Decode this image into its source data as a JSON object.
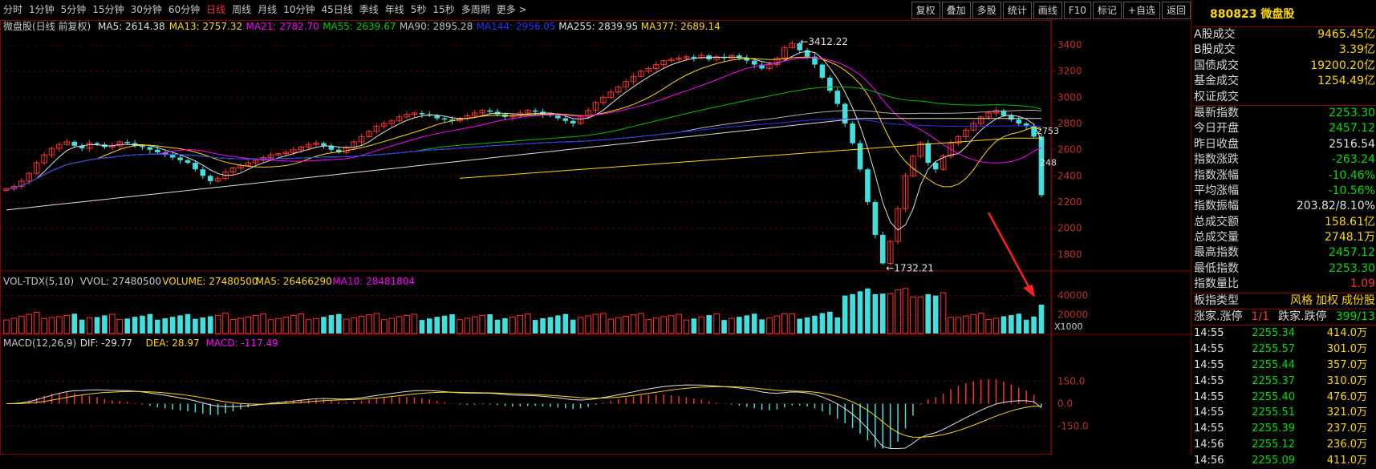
{
  "toolbar": {
    "tabs": [
      "分时",
      "1分钟",
      "5分钟",
      "15分钟",
      "30分钟",
      "60分钟",
      "日线",
      "周线",
      "月线",
      "10分钟",
      "45日线",
      "季线",
      "年线",
      "5秒",
      "15秒",
      "多周期",
      "更多 >"
    ],
    "active_tab": "日线",
    "right_buttons": [
      "复权",
      "叠加",
      "多股",
      "统计",
      "画线",
      "F10",
      "标记",
      "+自选",
      "返回"
    ]
  },
  "main_panel": {
    "title": "微盘股(日线 前复权)",
    "ma_legend": [
      {
        "label": "MA5: 2614.38",
        "color": "#e0e0e0"
      },
      {
        "label": "MA13: 2757.32",
        "color": "#ffd700"
      },
      {
        "label": "MA21: 2782.70",
        "color": "#ff00ff"
      },
      {
        "label": "MA55: 2639.67",
        "color": "#00d000"
      },
      {
        "label": "MA90: 2895.28",
        "color": "#c0c0c0"
      },
      {
        "label": "MA144: 2956.05",
        "color": "#2233ff"
      },
      {
        "label": "MA255: 2839.95",
        "color": "#e0e0e0"
      },
      {
        "label": "MA377: 2689.14",
        "color": "#ffd700"
      }
    ],
    "annotations": {
      "high": "3412.22",
      "low": "1732.21",
      "right_a": "2753",
      "right_b": "248"
    }
  },
  "vol_panel": {
    "legend": [
      {
        "label": "VOL-TDX(5,10)",
        "color": "#c8c8c8"
      },
      {
        "label": "VVOL: 27480500",
        "color": "#c8c8c8"
      },
      {
        "label": "VOLUME: 27480500",
        "color": "#ffd700"
      },
      {
        "label": "MA5: 26466290",
        "color": "#ffd700"
      },
      {
        "label": "MA10: 28481804",
        "color": "#ff00ff"
      }
    ],
    "unit": "X1000"
  },
  "macd_panel": {
    "legend": [
      {
        "label": "MACD(12,26,9)",
        "color": "#c8c8c8"
      },
      {
        "label": "DIF: -29.77",
        "color": "#e0e0e0"
      },
      {
        "label": "DEA: 28.97",
        "color": "#ffd700"
      },
      {
        "label": "MACD: -117.49",
        "color": "#ff00ff"
      }
    ]
  },
  "chart_data": [
    {
      "type": "candlestick",
      "title": "微盘股(日线 前复权)",
      "yticks": [
        1800,
        2000,
        2200,
        2400,
        2600,
        2800,
        3000,
        3200,
        3400
      ],
      "ylim": [
        1680,
        3480
      ],
      "grid": true,
      "close_series": [
        2300,
        2320,
        2360,
        2420,
        2500,
        2560,
        2610,
        2640,
        2660,
        2630,
        2610,
        2650,
        2640,
        2620,
        2630,
        2660,
        2650,
        2630,
        2620,
        2600,
        2580,
        2560,
        2540,
        2520,
        2500,
        2450,
        2400,
        2360,
        2380,
        2430,
        2460,
        2480,
        2500,
        2520,
        2540,
        2560,
        2570,
        2580,
        2600,
        2620,
        2640,
        2650,
        2630,
        2600,
        2580,
        2620,
        2660,
        2700,
        2740,
        2780,
        2800,
        2820,
        2850,
        2870,
        2880,
        2870,
        2860,
        2840,
        2830,
        2820,
        2840,
        2860,
        2880,
        2900,
        2890,
        2870,
        2850,
        2860,
        2880,
        2900,
        2890,
        2870,
        2860,
        2840,
        2820,
        2800,
        2850,
        2900,
        2960,
        3000,
        3040,
        3080,
        3120,
        3160,
        3200,
        3220,
        3250,
        3280,
        3290,
        3300,
        3310,
        3300,
        3320,
        3290,
        3310,
        3300,
        3320,
        3300,
        3280,
        3250,
        3220,
        3250,
        3300,
        3380,
        3412,
        3360,
        3310,
        3250,
        3150,
        3050,
        2950,
        2800,
        2650,
        2450,
        2200,
        1950,
        1732,
        1900,
        2150,
        2400,
        2550,
        2650,
        2500,
        2450,
        2550,
        2650,
        2700,
        2750,
        2800,
        2850,
        2880,
        2900,
        2860,
        2830,
        2800,
        2780,
        2700,
        2253
      ],
      "annotations": [
        {
          "label": "3412.22",
          "kind": "high"
        },
        {
          "label": "1732.21",
          "kind": "low"
        }
      ]
    },
    {
      "type": "bar",
      "title": "VOL-TDX(5,10)",
      "yticks": [
        20000,
        40000
      ],
      "unit": "X1000",
      "last_volume": 27480500,
      "ma5": 26466290,
      "ma10": 28481804
    },
    {
      "type": "bar",
      "title": "MACD(12,26,9)",
      "yticks": [
        -150.0,
        0.0,
        150.0
      ],
      "dif": -29.77,
      "dea": 28.97,
      "macd": -117.49
    }
  ],
  "side": {
    "title": "880823 微盘股",
    "section1": [
      {
        "label": "A股成交",
        "value": "9465.45亿",
        "cls": "v-yellow"
      },
      {
        "label": "B股成交",
        "value": "3.39亿",
        "cls": "v-yellow"
      },
      {
        "label": "国债成交",
        "value": "19200.20亿",
        "cls": "v-yellow"
      },
      {
        "label": "基金成交",
        "value": "1254.49亿",
        "cls": "v-yellow"
      },
      {
        "label": "权证成交",
        "value": "",
        "cls": "v-yellow"
      }
    ],
    "section2": [
      {
        "label": "最新指数",
        "value": "2253.30",
        "cls": "v-green"
      },
      {
        "label": "今日开盘",
        "value": "2457.12",
        "cls": "v-green"
      },
      {
        "label": "昨日收盘",
        "value": "2516.54",
        "cls": "v-white"
      },
      {
        "label": "指数涨跌",
        "value": "-263.24",
        "cls": "v-green"
      },
      {
        "label": "指数涨幅",
        "value": "-10.46%",
        "cls": "v-green"
      },
      {
        "label": "平均涨幅",
        "value": "-10.56%",
        "cls": "v-green"
      },
      {
        "label": "指数振幅",
        "value": "203.82/8.10%",
        "cls": "v-white"
      },
      {
        "label": "总成交额",
        "value": "158.61亿",
        "cls": "v-yellow"
      },
      {
        "label": "总成交量",
        "value": "2748.1万",
        "cls": "v-yellow"
      },
      {
        "label": "最高指数",
        "value": "2457.12",
        "cls": "v-green"
      },
      {
        "label": "最低指数",
        "value": "2253.30",
        "cls": "v-green"
      },
      {
        "label": "指数量比",
        "value": "1.09",
        "cls": "v-red"
      }
    ],
    "board_type": {
      "label": "板指类型",
      "tags": [
        "风格",
        "加权",
        "成份股"
      ]
    },
    "limit_row": {
      "label1": "涨家.涨停",
      "value1": "1/1",
      "label2": "跌家.跌停",
      "value2": "399/13"
    },
    "ticks": [
      {
        "time": "14:55",
        "price": "2255.34",
        "vol": "414.0万"
      },
      {
        "time": "14:55",
        "price": "2255.57",
        "vol": "301.0万"
      },
      {
        "time": "14:55",
        "price": "2255.44",
        "vol": "357.0万"
      },
      {
        "time": "14:55",
        "price": "2255.37",
        "vol": "310.0万"
      },
      {
        "time": "14:55",
        "price": "2255.40",
        "vol": "476.0万"
      },
      {
        "time": "14:55",
        "price": "2255.51",
        "vol": "321.0万"
      },
      {
        "time": "14:55",
        "price": "2255.39",
        "vol": "237.0万"
      },
      {
        "time": "14:56",
        "price": "2255.12",
        "vol": "236.0万"
      },
      {
        "time": "14:56",
        "price": "2255.09",
        "vol": "411.0万"
      }
    ]
  }
}
